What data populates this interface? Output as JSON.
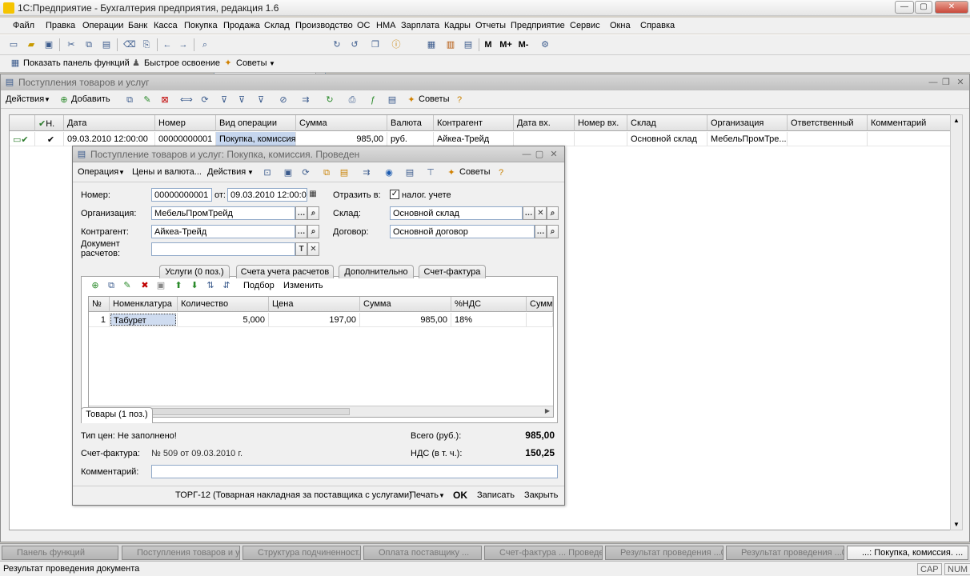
{
  "app": {
    "title": "1С:Предприятие - Бухгалтерия предприятия, редакция 1.6",
    "win_min": "—",
    "win_max": "▢",
    "win_close": "✕"
  },
  "menu": [
    "Файл",
    "Правка",
    "Операции",
    "Банк",
    "Касса",
    "Покупка",
    "Продажа",
    "Склад",
    "Производство",
    "ОС",
    "НМА",
    "Зарплата",
    "Кадры",
    "Отчеты",
    "Предприятие",
    "Сервис",
    "Окна",
    "Справка"
  ],
  "toolbar": {
    "m_label": "M",
    "mplus_label": "M+",
    "mminus_label": "M-"
  },
  "toolbar2": {
    "show_panel": "Показать панель функций",
    "quick_learn": "Быстрое освоение",
    "tips": "Советы"
  },
  "list": {
    "title": "Поступления товаров и услуг",
    "toolbar": {
      "actions": "Действия",
      "add": "Добавить",
      "tips": "Советы"
    },
    "columns": [
      "Н.",
      "Дата",
      "Номер",
      "Вид операции",
      "Сумма",
      "Валюта",
      "Контрагент",
      "Дата вх.",
      "Номер вх.",
      "Склад",
      "Организация",
      "Ответственный",
      "Комментарий"
    ],
    "rows": [
      {
        "date": "09.03.2010 12:00:00",
        "number": "00000000001",
        "op_type": "Покупка, комиссия",
        "sum": "985,00",
        "currency": "руб.",
        "counterparty": "Айкеа-Трейд",
        "in_date": "",
        "in_number": "",
        "warehouse": "Основной склад",
        "org": "МебельПромТре...",
        "responsible": "",
        "comment": ""
      }
    ]
  },
  "doc": {
    "title": "Поступление товаров и услуг: Покупка, комиссия. Проведен",
    "toolbar": {
      "operation": "Операция",
      "prices": "Цены и валюта...",
      "actions": "Действия",
      "tips": "Советы"
    },
    "labels": {
      "number": "Номер:",
      "from": "от:",
      "reflect": "Отразить в:",
      "tax_acc": "налог. учете",
      "org": "Организация:",
      "warehouse": "Склад:",
      "counterparty": "Контрагент:",
      "contract": "Договор:",
      "settle_doc_1": "Документ",
      "settle_doc_2": "расчетов:"
    },
    "values": {
      "number": "00000000001",
      "date": "09.03.2010 12:00:00",
      "org": "МебельПромТрейд",
      "warehouse": "Основной склад",
      "counterparty": "Айкеа-Трейд",
      "contract": "Основной договор",
      "settle_doc": ""
    },
    "tabs": [
      "Товары (1 поз.)",
      "Услуги (0 поз.)",
      "Счета учета расчетов",
      "Дополнительно",
      "Счет-фактура"
    ],
    "items_toolbar": {
      "pick": "Подбор",
      "change": "Изменить"
    },
    "items_columns": [
      "№",
      "Номенклатура",
      "Количество",
      "Цена",
      "Сумма",
      "%НДС",
      "Сумма"
    ],
    "items": [
      {
        "n": "1",
        "name": "Табурет",
        "qty": "5,000",
        "price": "197,00",
        "sum": "985,00",
        "vat": "18%",
        "vat_sum": ""
      }
    ],
    "footer": {
      "price_type": "Тип цен: Не заполнено!",
      "total_label": "Всего (руб.):",
      "total": "985,00",
      "invoice_label": "Счет-фактура:",
      "invoice": "№ 509 от 09.03.2010 г.",
      "vat_label": "НДС (в т. ч.):",
      "vat": "150,25",
      "comment_label": "Комментарий:",
      "comment": ""
    },
    "bottom": {
      "torg": "ТОРГ-12 (Товарная накладная за поставщика с услугами)",
      "print": "Печать",
      "ok": "OK",
      "save": "Записать",
      "close": "Закрыть"
    }
  },
  "taskbar": [
    "Панель функций",
    "Поступления товаров и у...",
    "Структура подчиненност...",
    "Оплата поставщику ...",
    "Счет-фактура ... Проведен",
    "Результат проведения ...00",
    "Результат проведения ...00",
    "...: Покупка, комиссия. ..."
  ],
  "status": {
    "message": "Результат проведения документа",
    "cap": "CAP",
    "num": "NUM"
  }
}
